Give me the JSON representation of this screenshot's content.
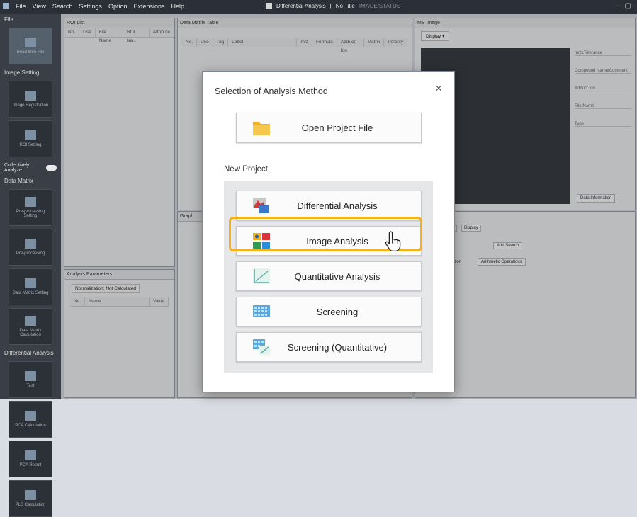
{
  "menubar": {
    "items": [
      "File",
      "View",
      "Search",
      "Settings",
      "Option",
      "Extensions",
      "Help"
    ],
    "window_title": "Differential Analysis",
    "project": "No Title",
    "mode": "IMAGE/STATUS"
  },
  "sidebar": {
    "file_header": "File",
    "file_tile": "Read Imm File",
    "image_setting_header": "Image Setting",
    "image_registration": "Image Registration",
    "roi_setting": "ROI Setting",
    "collectively_label": "Collectively Analyze",
    "data_matrix_header": "Data Matrix",
    "pre_processing_setting": "Pre-processing Setting",
    "pre_processing": "Pre-processing",
    "data_matrix_setting": "Data Matrix Setting",
    "data_matrix_calc": "Data Matrix Calculation",
    "diff_header": "Differential Analysis",
    "test": "Test",
    "pca_calc": "PCA Calculation",
    "pca_result": "PCA Result",
    "plsda_calc": "PLS Calculation"
  },
  "roi_list": {
    "title": "ROI List",
    "columns": [
      "No.",
      "Use",
      "File Name",
      "ROI Na...",
      "Attribute"
    ]
  },
  "analysis_params": {
    "title": "Analysis Parameters",
    "status": "Normalization: Not Calculated",
    "columns": [
      "No.",
      "Name",
      "Value"
    ]
  },
  "data_matrix": {
    "title": "Data Matrix Table",
    "columns": [
      "No.",
      "Use",
      "Tag",
      "Label",
      "m/z",
      "Formula",
      "Adduct Ion",
      "Matrix",
      "Polarity"
    ]
  },
  "graph": {
    "title": "Graph"
  },
  "ms_image": {
    "title": "MS Image",
    "display_label": "Display",
    "fields": [
      "m/z±Tolerance",
      "Compound Name/Comment",
      "Adduct Ion",
      "File Name",
      "Type"
    ],
    "data_info_button": "Data Information"
  },
  "lower_toolbar": {
    "sort_label": "Sort",
    "display_label": "Display",
    "add_search_label": "Add Search",
    "arithmetic_label": "Arithmetic Operations",
    "left_label": "ation"
  },
  "dialog": {
    "title": "Selection of Analysis Method",
    "close": "×",
    "open_project": "Open Project File",
    "new_project_label": "New Project",
    "options": [
      "Differential Analysis",
      "Image Analysis",
      "Quantitative Analysis",
      "Screening",
      "Screening (Quantitative)"
    ],
    "highlighted_option": "Image Analysis"
  },
  "colors": {
    "highlight": "#f3b21b",
    "dialog_border": "#7a8796",
    "sidebar_bg": "#3a3f47"
  }
}
